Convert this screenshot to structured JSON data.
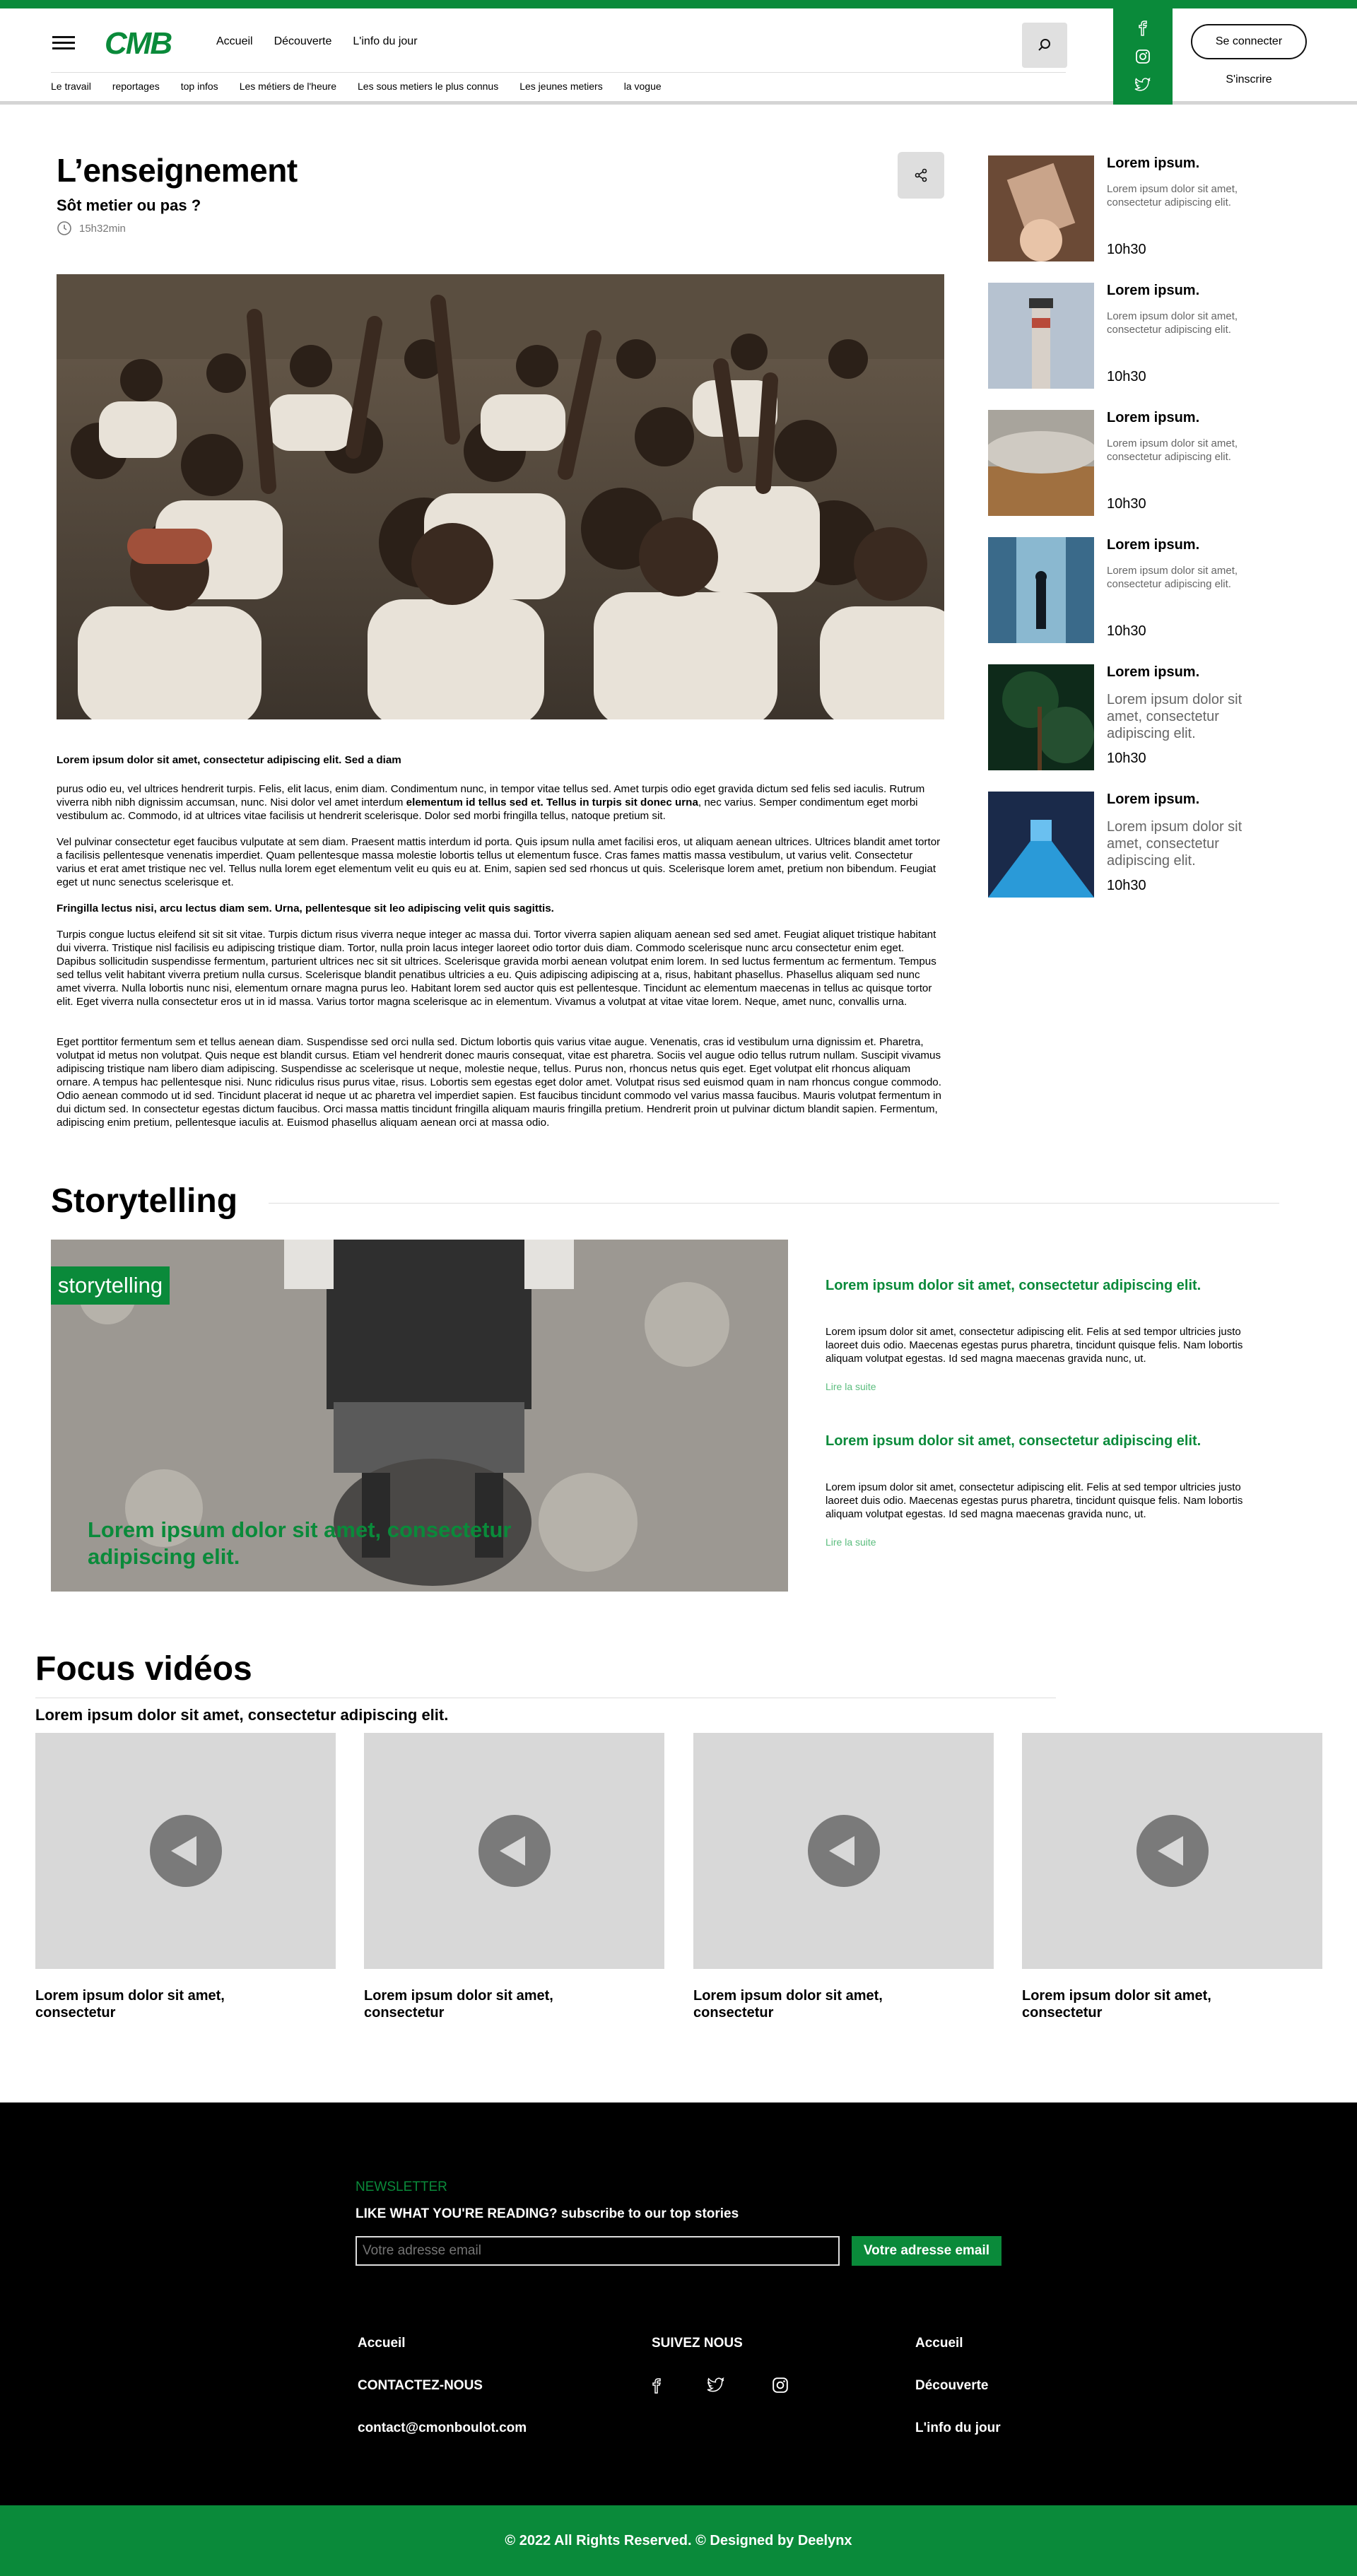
{
  "header": {
    "nav": [
      "Accueil",
      "Découverte",
      "L'info du jour"
    ],
    "subnav": [
      "Le travail",
      "reportages",
      "top infos",
      "Les métiers de l'heure",
      "Les sous metiers le plus connus",
      "Les jeunes metiers",
      "la vogue"
    ],
    "login_label": "Se connecter",
    "signup_label": "S'inscrire",
    "icons": [
      "hamburger-menu-icon",
      "search-icon",
      "facebook-icon",
      "instagram-icon",
      "twitter-icon"
    ]
  },
  "article": {
    "title": "L’enseignement",
    "subtitle": "Sôt metier ou pas ?",
    "duration": "15h32min",
    "intro": "Lorem ipsum dolor sit amet, consectetur adipiscing elit. Sed a diam",
    "p1": " purus odio eu, vel ultrices hendrerit turpis. Felis, elit lacus, enim diam. Condimentum nunc, in tempor vitae tellus sed. Amet turpis odio eget gravida dictum sed felis sed iaculis. Rutrum viverra nibh nibh dignissim accumsan, nunc. Nisi dolor vel amet interdum ",
    "p1_bold": "elementum id tellus sed et. Tellus in turpis sit donec urna",
    "p1_end": ", nec varius. Semper condimentum eget morbi vestibulum ac. Commodo, id at ultrices vitae facilisis ut hendrerit scelerisque. Dolor sed morbi fringilla tellus, natoque pretium sit.",
    "p2": "Vel pulvinar consectetur eget faucibus vulputate at sem diam. Praesent mattis interdum id porta. Quis ipsum nulla amet facilisi eros, ut aliquam aenean ultrices. Ultrices blandit amet tortor a facilisis pellentesque venenatis imperdiet. Quam pellentesque massa molestie lobortis tellus ut elementum fusce. Cras fames mattis massa vestibulum, ut varius velit. Consectetur varius et erat amet tristique nec vel. Tellus nulla lorem eget elementum velit eu quis eu at. Enim, sapien sed sed rhoncus ut quis. Scelerisque lorem amet, pretium non bibendum. Feugiat eget ut nunc senectus scelerisque et.",
    "p3_bold": " Fringilla lectus nisi, arcu lectus diam sem. Urna, pellentesque sit leo adipiscing velit quis sagittis.",
    "p4": " Turpis congue luctus eleifend sit sit sit vitae. Turpis dictum risus viverra neque integer ac massa dui. Tortor viverra sapien aliquam aenean sed sed amet. Feugiat aliquet tristique habitant dui viverra. Tristique nisl facilisis eu adipiscing tristique diam. Tortor, nulla proin lacus integer laoreet odio tortor duis diam. Commodo scelerisque nunc arcu consectetur enim eget. Dapibus sollicitudin suspendisse fermentum, parturient ultrices nec sit sit ultrices. Scelerisque gravida morbi aenean volutpat enim lorem. In sed luctus fermentum ac fermentum. Tempus sed tellus velit habitant viverra pretium nulla cursus. Scelerisque blandit penatibus ultricies a eu. Quis adipiscing adipiscing at a, risus, habitant phasellus. Phasellus aliquam sed nunc amet viverra. Nulla lobortis nunc nisi, elementum ornare magna purus leo. Habitant lorem sed auctor quis est pellentesque. Tincidunt ac elementum maecenas in tellus ac quisque tortor elit. Eget viverra nulla consectetur eros ut in id massa. Varius tortor magna scelerisque ac in elementum. Vivamus a volutpat at vitae vitae lorem. Neque, amet nunc, convallis urna.",
    "p5": " Eget porttitor fermentum sem et tellus aenean diam. Suspendisse sed orci nulla sed. Dictum lobortis quis varius vitae augue. Venenatis, cras id vestibulum urna dignissim et. Pharetra, volutpat id metus non volutpat. Quis neque est blandit cursus. Etiam vel hendrerit donec mauris consequat, vitae est pharetra. Sociis vel augue odio tellus rutrum nullam. Suscipit vivamus adipiscing tristique nam libero diam adipiscing. Suspendisse ac scelerisque ut neque, molestie neque, tellus. Purus non, rhoncus netus quis eget. Eget volutpat elit rhoncus aliquam ornare. A tempus hac pellentesque nisi. Nunc ridiculus risus purus vitae, risus. Lobortis sem egestas eget dolor amet. Volutpat risus sed euismod quam in nam rhoncus congue commodo. Odio aenean commodo ut id sed. Tincidunt placerat id neque ut ac pharetra vel imperdiet sapien. Est faucibus tincidunt commodo vel varius massa faucibus. Mauris volutpat fermentum in dui dictum sed. In consectetur egestas dictum faucibus. Orci massa mattis tincidunt fringilla aliquam mauris fringilla pretium. Hendrerit proin ut pulvinar dictum blandit sapien. Fermentum, adipiscing enim pretium, pellentesque iaculis at. Euismod phasellus aliquam aenean orci at massa odio."
  },
  "sidebar": [
    {
      "title": "Lorem ipsum.",
      "desc": "Lorem ipsum dolor sit amet, consectetur adipiscing elit.",
      "time": "10h30"
    },
    {
      "title": "Lorem ipsum.",
      "desc": "Lorem ipsum dolor sit amet, consectetur adipiscing elit.",
      "time": "10h30"
    },
    {
      "title": "Lorem ipsum.",
      "desc": "Lorem ipsum dolor sit amet, consectetur adipiscing elit.",
      "time": "10h30"
    },
    {
      "title": "Lorem ipsum.",
      "desc": "Lorem ipsum dolor sit amet, consectetur adipiscing elit.",
      "time": "10h30"
    },
    {
      "title": "Lorem ipsum.",
      "desc": "Lorem ipsum dolor sit amet, consectetur adipiscing elit.",
      "time": "10h30"
    },
    {
      "title": "Lorem ipsum.",
      "desc": "Lorem ipsum dolor sit amet, consectetur adipiscing elit.",
      "time": "10h30"
    }
  ],
  "storytelling": {
    "heading": "Storytelling",
    "badge": "storytelling",
    "caption": "Lorem ipsum dolor sit amet, consectetur adipiscing elit.",
    "items": [
      {
        "title": "Lorem ipsum dolor sit amet, consectetur adipiscing elit.",
        "desc": "Lorem ipsum dolor sit amet, consectetur adipiscing elit. Felis at sed tempor ultricies justo laoreet duis odio. Maecenas egestas purus pharetra, tincidunt quisque felis. Nam lobortis aliquam volutpat egestas. Id sed magna maecenas gravida nunc, ut.",
        "link": "Lire la suite"
      },
      {
        "title": "Lorem ipsum dolor sit amet, consectetur adipiscing elit.",
        "desc": "Lorem ipsum dolor sit amet, consectetur adipiscing elit. Felis at sed tempor ultricies justo laoreet duis odio. Maecenas egestas purus pharetra, tincidunt quisque felis. Nam lobortis aliquam volutpat egestas. Id sed magna maecenas gravida nunc, ut.",
        "link": "Lire la suite"
      }
    ]
  },
  "videos": {
    "heading": "Focus vidéos",
    "subheading": "Lorem ipsum dolor sit amet, consectetur adipiscing elit.",
    "items": [
      {
        "caption": "Lorem ipsum dolor sit amet, consectetur"
      },
      {
        "caption": "Lorem ipsum dolor sit amet, consectetur"
      },
      {
        "caption": "Lorem ipsum dolor sit amet, consectetur"
      },
      {
        "caption": "Lorem ipsum dolor sit amet, consectetur"
      }
    ]
  },
  "footer": {
    "newsletter_label": "NEWSLETTER",
    "newsletter_title": "LIKE WHAT YOU'RE READING? subscribe to our top stories",
    "email_placeholder": "Votre adresse email",
    "submit_label": "Votre adresse email",
    "col1": [
      "Accueil",
      "CONTACTEZ-NOUS",
      "contact@cmonboulot.com"
    ],
    "follow_label": "SUIVEZ NOUS",
    "col3": [
      "Accueil",
      "Découverte",
      "L'info du jour"
    ],
    "copyright": "© 2022 All Rights Reserved. © Designed by Deelynx"
  },
  "colors": {
    "brand_green": "#0a8a3a",
    "footer_bg": "#000000"
  }
}
